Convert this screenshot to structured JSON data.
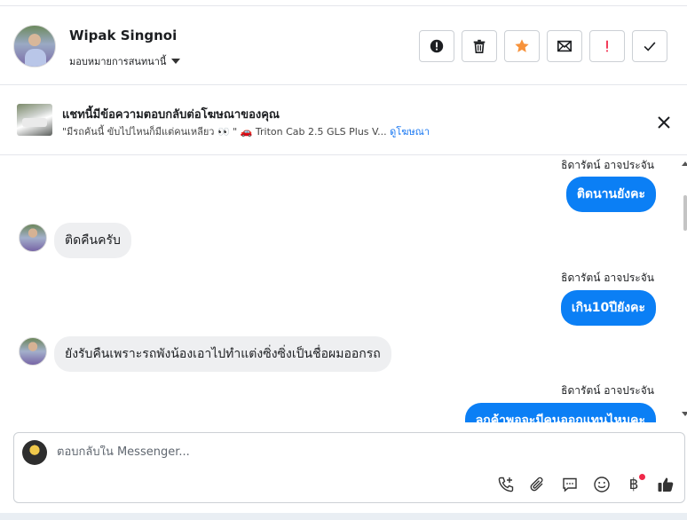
{
  "header": {
    "contact_name": "Wipak Singnoi",
    "assign_label": "มอบหมายการสนทนานี้",
    "actions": [
      {
        "name": "spam-button",
        "icon": "alert-circle-icon"
      },
      {
        "name": "delete-button",
        "icon": "trash-icon"
      },
      {
        "name": "star-button",
        "icon": "star-icon"
      },
      {
        "name": "mark-unread-button",
        "icon": "envelope-icon"
      },
      {
        "name": "follow-up-button",
        "icon": "exclamation-icon"
      },
      {
        "name": "done-button",
        "icon": "check-icon"
      }
    ]
  },
  "ad_banner": {
    "title": "แชทนี้มีข้อความตอบกลับต่อโฆษณาของคุณ",
    "subtitle": "\"มีรถคันนี้ ขับไปไหนก็มีแต่คนเหลียว 👀 \" 🚗 Triton Cab 2.5 GLS Plus V...",
    "link": "ดูโฆษณา"
  },
  "messages": [
    {
      "direction": "out",
      "sender": "ธิดารัตน์ อาจประจัน",
      "text": "ติดนานยังคะ"
    },
    {
      "direction": "in",
      "text": "ติดคืนครับ"
    },
    {
      "direction": "out",
      "sender": "ธิดารัตน์ อาจประจัน",
      "text": "เกิน10ปียังคะ"
    },
    {
      "direction": "in",
      "text": "ยังรับคืนเพราะรถพังน้องเอาไปทำแต่งซิ่งซิ่งเป็นชื่อผมออกรถ"
    },
    {
      "direction": "out",
      "sender": "ธิดารัตน์ อาจประจัน",
      "text": "ลูกค้าพอจะมีคนออกแทนไหมคะ"
    }
  ],
  "composer": {
    "placeholder": "ตอบกลับใน Messenger...",
    "baht_symbol": "฿",
    "tools": [
      "phone-plus-icon",
      "paperclip-icon",
      "saved-replies-icon",
      "emoji-icon",
      "baht-icon",
      "thumbs-up-icon"
    ]
  },
  "colors": {
    "accent": "#0b7ff5",
    "star": "#f7923a",
    "follow_up": "#f02849"
  }
}
